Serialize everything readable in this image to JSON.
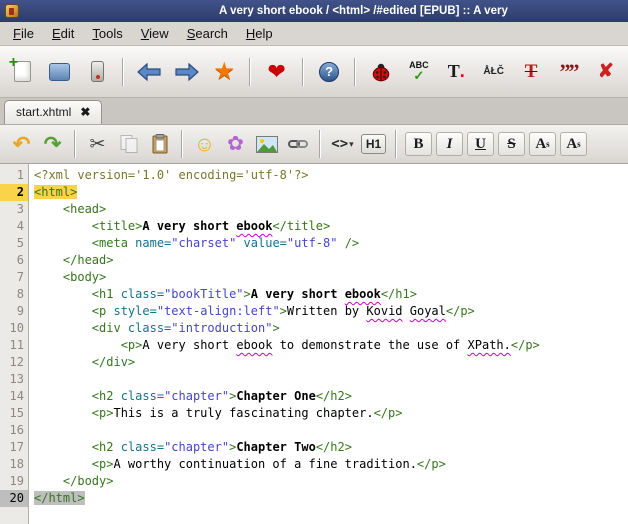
{
  "window": {
    "title": "A very short ebook / <html> /#edited [EPUB] :: A very",
    "titlebar_bg": "#2c3c68"
  },
  "menu": {
    "items": [
      {
        "accel": "F",
        "rest": "ile"
      },
      {
        "accel": "E",
        "rest": "dit"
      },
      {
        "accel": "T",
        "rest": "ools"
      },
      {
        "accel": "V",
        "rest": "iew"
      },
      {
        "accel": "S",
        "rest": "earch"
      },
      {
        "accel": "H",
        "rest": "elp"
      }
    ]
  },
  "toolbar_main": {
    "new_plus": "+",
    "bookmark_star": "★",
    "heart": "❤",
    "help_mark": "?",
    "spellcheck_abc": "ABC",
    "spellcheck_check": "✓",
    "case_letter": "T",
    "case_dot": ".",
    "special_chars": "ÅŁČ",
    "strike_letter": "T",
    "quotes": "””",
    "delete_mark": "✘"
  },
  "tab": {
    "label": "start.xhtml",
    "close_glyph": "✖"
  },
  "toolbar_edit": {
    "undo": "↶",
    "redo": "↷",
    "cut": "✂",
    "smiley": "☺",
    "flower": "✿",
    "tag_glyph": "<>",
    "tag_caret": "▾",
    "heading": "H1",
    "bold": "B",
    "italic": "I",
    "underline": "U",
    "strike": "S",
    "script_a": "A",
    "script_s": "s"
  },
  "editor": {
    "colors": {
      "tag": "#35761c",
      "attribute": "#15718d",
      "string": "#4545c8",
      "processing_instruction": "#77772e",
      "text": "#000000",
      "misspelled_underline": "#cc00cc",
      "current_line_bg": "#f9d34a",
      "matching_tag_bg": "#bebebe",
      "gutter_bg": "#eceae6",
      "gutter_text": "#8c8880"
    },
    "lines": [
      {
        "num": 1,
        "seg": [
          [
            "pi",
            "<?xml version='1.0' encoding='utf-8'?>"
          ]
        ]
      },
      {
        "num": 2,
        "hl": "current",
        "seg": [
          [
            "tag",
            "<html>"
          ]
        ]
      },
      {
        "num": 3,
        "seg": [
          [
            "txt",
            "    "
          ],
          [
            "tag",
            "<head>"
          ]
        ]
      },
      {
        "num": 4,
        "seg": [
          [
            "txt",
            "        "
          ],
          [
            "tag",
            "<title>"
          ],
          [
            "b",
            "A very short "
          ],
          [
            "bsp",
            "ebook"
          ],
          [
            "tag",
            "</title>"
          ]
        ]
      },
      {
        "num": 5,
        "seg": [
          [
            "txt",
            "        "
          ],
          [
            "tag",
            "<meta "
          ],
          [
            "attr",
            "name="
          ],
          [
            "str",
            "\"charset\""
          ],
          [
            "txt",
            " "
          ],
          [
            "attr",
            "value="
          ],
          [
            "str",
            "\"utf-8\""
          ],
          [
            "tag",
            " />"
          ]
        ]
      },
      {
        "num": 6,
        "seg": [
          [
            "txt",
            "    "
          ],
          [
            "tag",
            "</head>"
          ]
        ]
      },
      {
        "num": 7,
        "seg": [
          [
            "txt",
            "    "
          ],
          [
            "tag",
            "<body>"
          ]
        ]
      },
      {
        "num": 8,
        "seg": [
          [
            "txt",
            "        "
          ],
          [
            "tag",
            "<h1 "
          ],
          [
            "attr",
            "class="
          ],
          [
            "str",
            "\"bookTitle\""
          ],
          [
            "tag",
            ">"
          ],
          [
            "b",
            "A very short "
          ],
          [
            "bsp",
            "ebook"
          ],
          [
            "tag",
            "</h1>"
          ]
        ]
      },
      {
        "num": 9,
        "seg": [
          [
            "txt",
            "        "
          ],
          [
            "tag",
            "<p "
          ],
          [
            "attr",
            "style="
          ],
          [
            "str",
            "\"text-align:left\""
          ],
          [
            "tag",
            ">"
          ],
          [
            "txt",
            "Written by "
          ],
          [
            "sp",
            "Kovid"
          ],
          [
            "txt",
            " "
          ],
          [
            "sp",
            "Goyal"
          ],
          [
            "tag",
            "</p>"
          ]
        ]
      },
      {
        "num": 10,
        "seg": [
          [
            "txt",
            "        "
          ],
          [
            "tag",
            "<div "
          ],
          [
            "attr",
            "class="
          ],
          [
            "str",
            "\"introduction\""
          ],
          [
            "tag",
            ">"
          ]
        ]
      },
      {
        "num": 11,
        "seg": [
          [
            "txt",
            "            "
          ],
          [
            "tag",
            "<p>"
          ],
          [
            "txt",
            "A very short "
          ],
          [
            "sp",
            "ebook"
          ],
          [
            "txt",
            " to demonstrate the use of "
          ],
          [
            "sp",
            "XPath."
          ],
          [
            "tag",
            "</p>"
          ]
        ]
      },
      {
        "num": 12,
        "seg": [
          [
            "txt",
            "        "
          ],
          [
            "tag",
            "</div>"
          ]
        ]
      },
      {
        "num": 13,
        "seg": []
      },
      {
        "num": 14,
        "seg": [
          [
            "txt",
            "        "
          ],
          [
            "tag",
            "<h2 "
          ],
          [
            "attr",
            "class="
          ],
          [
            "str",
            "\"chapter\""
          ],
          [
            "tag",
            ">"
          ],
          [
            "b",
            "Chapter One"
          ],
          [
            "tag",
            "</h2>"
          ]
        ]
      },
      {
        "num": 15,
        "seg": [
          [
            "txt",
            "        "
          ],
          [
            "tag",
            "<p>"
          ],
          [
            "txt",
            "This is a truly fascinating chapter."
          ],
          [
            "tag",
            "</p>"
          ]
        ]
      },
      {
        "num": 16,
        "seg": []
      },
      {
        "num": 17,
        "seg": [
          [
            "txt",
            "        "
          ],
          [
            "tag",
            "<h2 "
          ],
          [
            "attr",
            "class="
          ],
          [
            "str",
            "\"chapter\""
          ],
          [
            "tag",
            ">"
          ],
          [
            "b",
            "Chapter Two"
          ],
          [
            "tag",
            "</h2>"
          ]
        ]
      },
      {
        "num": 18,
        "seg": [
          [
            "txt",
            "        "
          ],
          [
            "tag",
            "<p>"
          ],
          [
            "txt",
            "A worthy continuation of a fine tradition."
          ],
          [
            "tag",
            "</p>"
          ]
        ]
      },
      {
        "num": 19,
        "seg": [
          [
            "txt",
            "    "
          ],
          [
            "tag",
            "</body>"
          ]
        ]
      },
      {
        "num": 20,
        "hl": "match",
        "seg": [
          [
            "tag",
            "</html>"
          ]
        ]
      }
    ]
  }
}
